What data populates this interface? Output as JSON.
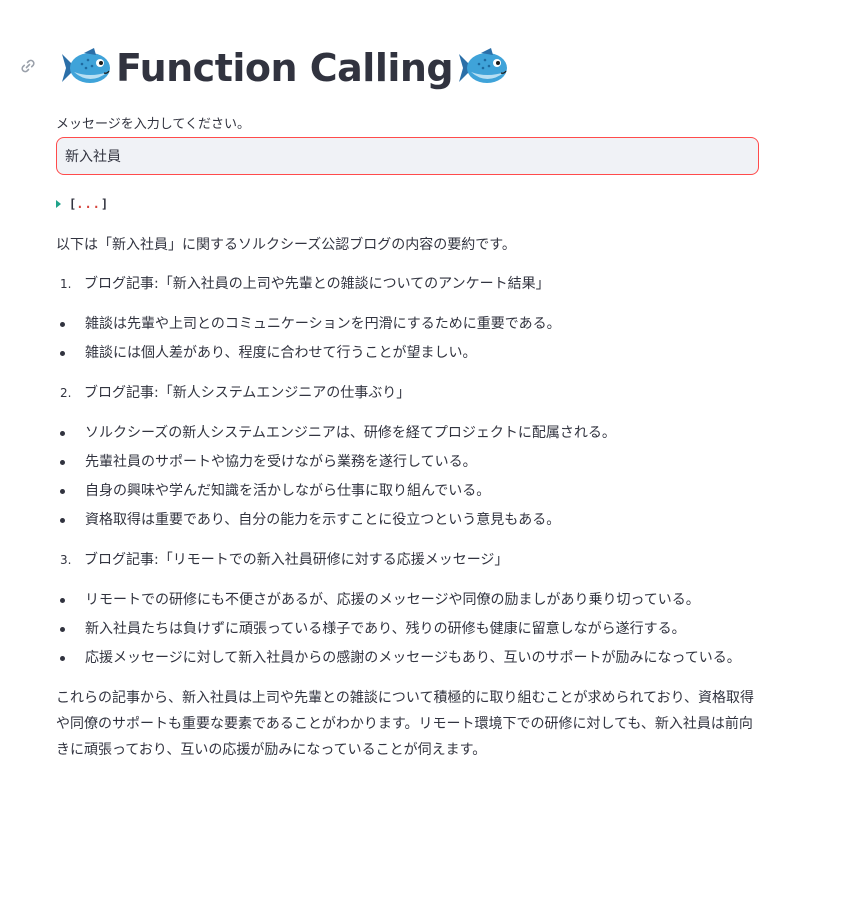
{
  "header": {
    "title": "Function Calling",
    "left_icon": "fish-emoji-icon",
    "right_icon": "fish-emoji-icon",
    "anchor_icon": "link-icon"
  },
  "input": {
    "label": "メッセージを入力してください。",
    "value": "新入社員"
  },
  "json_viewer": {
    "open_bracket": "[",
    "ellipsis": "...",
    "close_bracket": "]",
    "state": "collapsed"
  },
  "response": {
    "intro": "以下は「新入社員」に関するソルクシーズ公認ブログの内容の要約です。",
    "sections": [
      {
        "number": "1.",
        "heading": "ブログ記事:「新入社員の上司や先輩との雑談についてのアンケート結果」",
        "bullets": [
          "雑談は先輩や上司とのコミュニケーションを円滑にするために重要である。",
          "雑談には個人差があり、程度に合わせて行うことが望ましい。"
        ]
      },
      {
        "number": "2.",
        "heading": "ブログ記事:「新人システムエンジニアの仕事ぶり」",
        "bullets": [
          "ソルクシーズの新人システムエンジニアは、研修を経てプロジェクトに配属される。",
          "先輩社員のサポートや協力を受けながら業務を遂行している。",
          "自身の興味や学んだ知識を活かしながら仕事に取り組んでいる。",
          "資格取得は重要であり、自分の能力を示すことに役立つという意見もある。"
        ]
      },
      {
        "number": "3.",
        "heading": "ブログ記事:「リモートでの新入社員研修に対する応援メッセージ」",
        "bullets": [
          "リモートでの研修にも不便さがあるが、応援のメッセージや同僚の励ましがあり乗り切っている。",
          "新入社員たちは負けずに頑張っている様子であり、残りの研修も健康に留意しながら遂行する。",
          "応援メッセージに対して新入社員からの感謝のメッセージもあり、互いのサポートが励みになっている。"
        ]
      }
    ],
    "conclusion": "これらの記事から、新入社員は上司や先輩との雑談について積極的に取り組むことが求められており、資格取得や同僚のサポートも重要な要素であることがわかります。リモート環境下での研修に対しても、新入社員は前向きに頑張っており、互いの応援が励みになっていることが伺えます。"
  },
  "colors": {
    "accent": "#ff4b4b",
    "text": "#31333f",
    "input_bg": "#f0f2f6",
    "caret": "#1fa38a"
  }
}
